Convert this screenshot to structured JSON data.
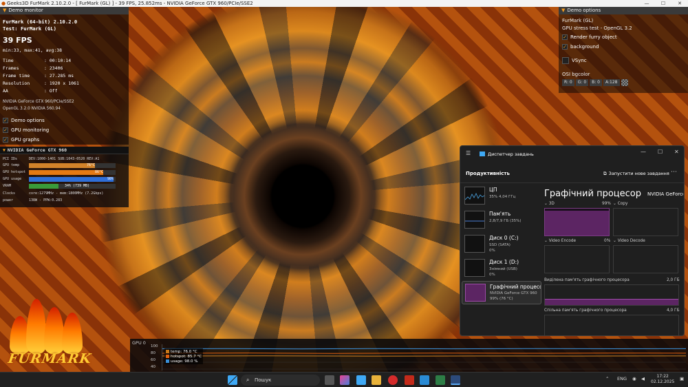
{
  "window": {
    "title": "Geeks3D FurMark 2.10.2.0 - [ FurMark (GL) ] - 39 FPS, 25.852ms - NVIDIA GeForce GTX 960/PCIe/SSE2"
  },
  "demo_monitor": {
    "header": "Demo monitor",
    "app": "FurMark (64-bit) 2.10.2.0",
    "test": "Test: FurMark (GL)",
    "fps": "39 FPS",
    "minmax": "min:33, max:41, avg:38",
    "stats": [
      {
        "key": "Time",
        "value": ": 00:10:14"
      },
      {
        "key": "Frames",
        "value": ": 23406"
      },
      {
        "key": "Frame time",
        "value": ": 27.285 ms"
      },
      {
        "key": "Resolution",
        "value": ": 1920 x 1061"
      },
      {
        "key": "AA",
        "value": ": Off"
      }
    ],
    "gpu_name": "NVIDIA GeForce GTX 960/PCIe/SSE2",
    "opengl": "OpenGL 3.2.0 NVIDIA 560.94",
    "checks": [
      "Demo options",
      "GPU monitoring",
      "GPU graphs"
    ]
  },
  "gpu_panel": {
    "header": "NVIDIA GeForce GTX 960",
    "pci_key": "PCI IDs",
    "pci_value": "DEV:1000-1401 SUB:1043-0520 REV:A1",
    "temp_key": "GPU temp",
    "temp_label": "76°C",
    "temp_fraction": 0.76,
    "hotspot_key": "GPU hotspot",
    "hotspot_label": "86°C",
    "hotspot_fraction": 0.86,
    "usage_key": "GPU usage",
    "usage_label": "98%",
    "usage_fraction": 0.98,
    "vram_key": "VRAM",
    "vram_label": "34% (739 MB)",
    "vram_fraction": 0.34,
    "clocks_key": "Clocks",
    "clocks_value": "core:1279MHz - mem:1800MHz (7.2Gbps)",
    "power_key": "power",
    "power_value": "138W - PPW:0.283"
  },
  "logo": {
    "text": "FURMARK"
  },
  "demo_options": {
    "header": "Demo options",
    "title": "FurMark (GL)",
    "subtitle": "GPU stress test - OpenGL 3.2",
    "render_furry": "Render furry object",
    "background": "background",
    "vsync": "VSync",
    "osi": "OSI bgcolor",
    "r": "R: 0",
    "g": "G: 0",
    "b": "B: 0",
    "a": "A:128"
  },
  "graph": {
    "title": "GPU 0",
    "scale": [
      "100",
      "80",
      "60",
      "40"
    ],
    "legend": [
      {
        "label": "temp: 76.0 °C",
        "color": "#c87818"
      },
      {
        "label": "hotspot: 85.7 °C",
        "color": "#e06010"
      },
      {
        "label": "usage: 98.0 %",
        "color": "#3a8fd8"
      }
    ]
  },
  "task_manager": {
    "title": "Диспетчер завдань",
    "section": "Продуктивність",
    "new_task": "Запустити нове завдання",
    "items": [
      {
        "label": "ЦП",
        "sub1": "35% 4,04 ГГц",
        "sub2": ""
      },
      {
        "label": "Пам'ять",
        "sub1": "2,8/7,9 ГБ (35%)",
        "sub2": ""
      },
      {
        "label": "Диск 0 (C:)",
        "sub1": "SSD (SATA)",
        "sub2": "0%"
      },
      {
        "label": "Диск 1 (D:)",
        "sub1": "Знімний (USB)",
        "sub2": "0%"
      },
      {
        "label": "Графічний процесор 0",
        "sub1": "NVIDIA GeForce GTX 960",
        "sub2": "99% (76 °C)"
      }
    ],
    "gpu_title": "Графічний процесор",
    "gpu_model": "NVIDIA GeForce GTX 960",
    "engines": [
      {
        "name": "3D",
        "value": "99%"
      },
      {
        "name": "Copy",
        "value": "0%"
      },
      {
        "name": "Video Encode",
        "value": "0%"
      },
      {
        "name": "Video Decode",
        "value": "0%"
      }
    ],
    "dedicated_label": "Виділена пам'ять графічного процесора",
    "dedicated_value": "2,0 ГБ",
    "shared_label": "Спільна пам'ять графічного процесора",
    "shared_value": "4,0 ГБ"
  },
  "taskbar": {
    "search": "Пошук",
    "lang": "ENG",
    "time": "17:22",
    "date": "02.12.2025"
  }
}
